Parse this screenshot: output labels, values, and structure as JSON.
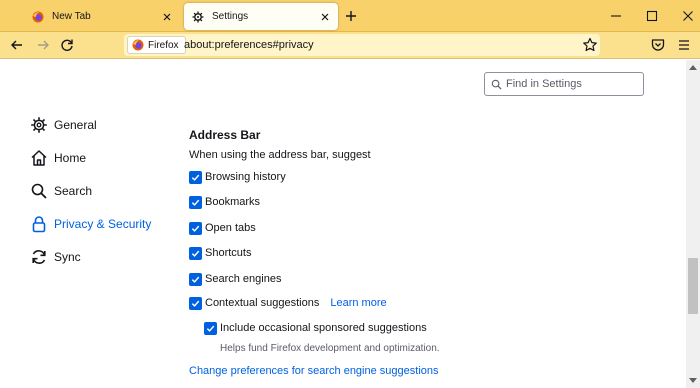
{
  "window": {
    "tabs": [
      {
        "title": "New Tab",
        "icon": "firefox-logo-icon"
      },
      {
        "title": "Settings",
        "icon": "gear-icon"
      }
    ],
    "controls": [
      "minimize-icon",
      "maximize-icon",
      "close-icon"
    ]
  },
  "navbar": {
    "identity_label": "Firefox",
    "url": "about:preferences#privacy"
  },
  "search": {
    "placeholder": "Find in Settings"
  },
  "sidebar": {
    "items": [
      {
        "label": "General",
        "icon": "gear-icon"
      },
      {
        "label": "Home",
        "icon": "home-icon"
      },
      {
        "label": "Search",
        "icon": "magnifier-icon"
      },
      {
        "label": "Privacy & Security",
        "icon": "lock-icon",
        "selected": true
      },
      {
        "label": "Sync",
        "icon": "sync-icon"
      }
    ]
  },
  "address_bar_section": {
    "title": "Address Bar",
    "description": "When using the address bar, suggest",
    "options": [
      {
        "label": "Browsing history",
        "checked": true
      },
      {
        "label": "Bookmarks",
        "checked": true
      },
      {
        "label": "Open tabs",
        "checked": true
      },
      {
        "label": "Shortcuts",
        "checked": true
      },
      {
        "label": "Search engines",
        "checked": true
      },
      {
        "label": "Contextual suggestions",
        "checked": true,
        "link": "Learn more"
      }
    ],
    "sub_option": {
      "label": "Include occasional sponsored suggestions",
      "checked": true
    },
    "sub_option_help": "Helps fund Firefox development and optimization.",
    "footer_link": "Change preferences for search engine suggestions"
  },
  "colors": {
    "tabstrip": "#f8d16a",
    "navbar": "#fbe18e",
    "accent": "#0061e0"
  }
}
